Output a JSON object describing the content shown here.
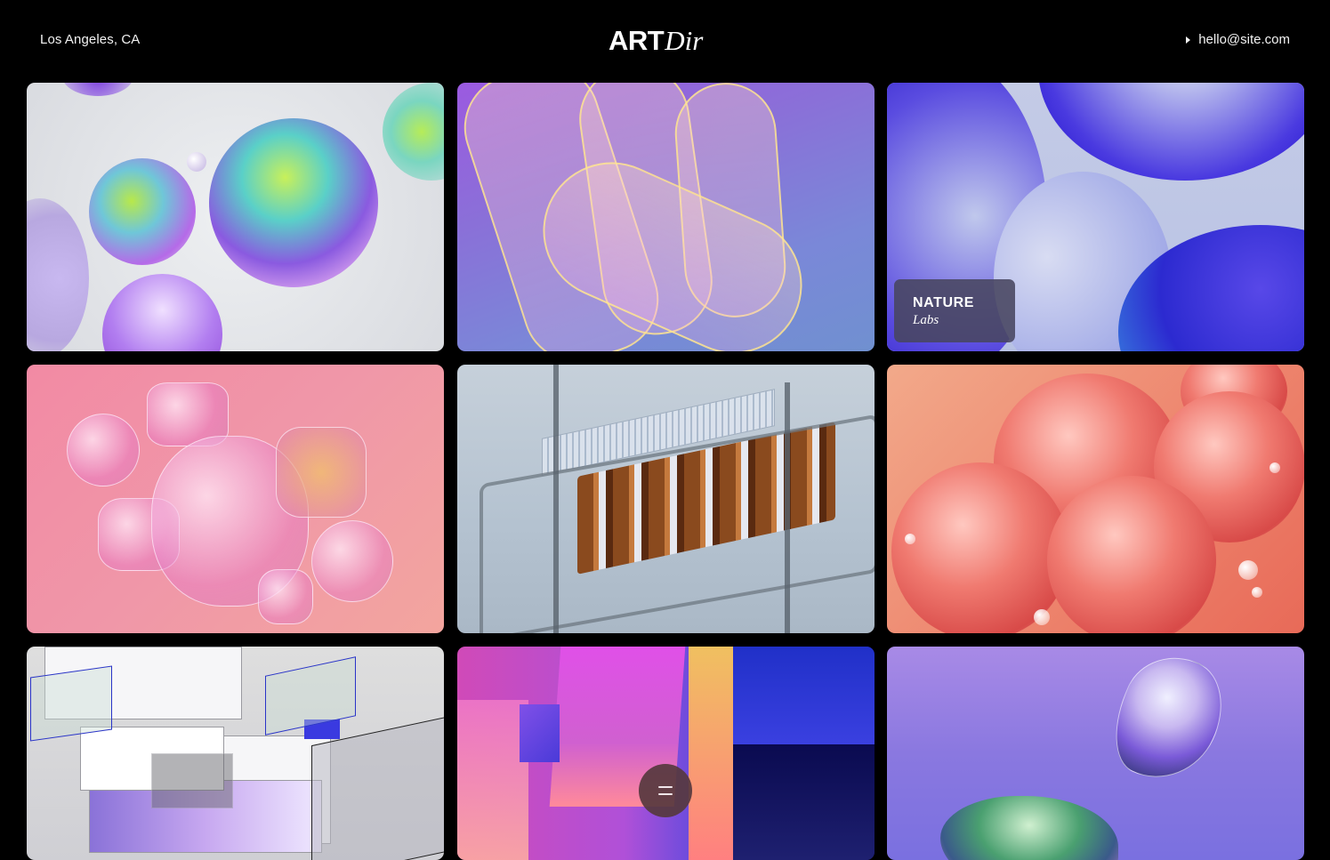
{
  "header": {
    "location": "Los Angeles, CA",
    "logo_main": "ART",
    "logo_sub": "Dir",
    "contact_email": "hello@site.com"
  },
  "icons": {
    "contact": "caret-right-icon",
    "menu": "menu-icon"
  },
  "grid": {
    "featured_badge": {
      "title": "NATURE",
      "subtitle": "Labs"
    }
  },
  "colors": {
    "background": "#000000",
    "text": "#f2f2f2",
    "badge_bg": "#484660",
    "menu_button_bg": "#56383e"
  }
}
